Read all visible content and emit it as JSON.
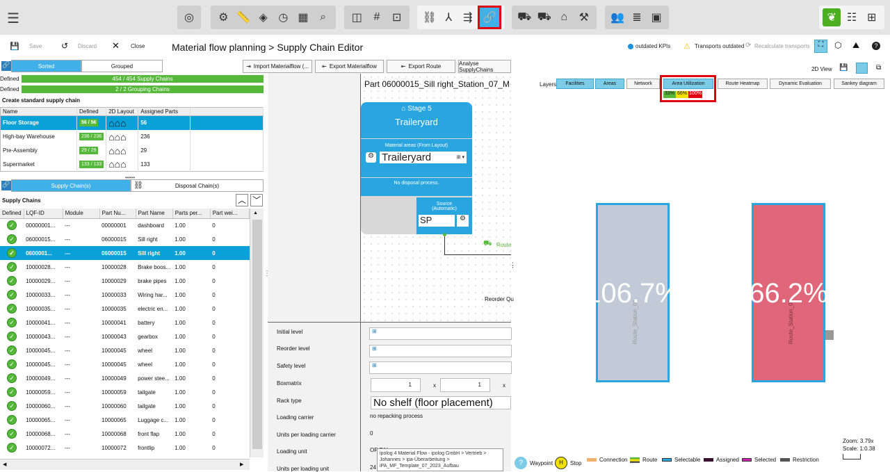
{
  "toolbar": {
    "icons": [
      "menu-icon",
      "target-icon",
      "material-icon",
      "ruler-icon",
      "shapes-icon",
      "clock-icon",
      "matrix-icon",
      "search-chart-icon",
      "layout-icon",
      "grid-icon",
      "area-icon",
      "link-icon",
      "branch-icon",
      "merge-icon",
      "chain-link-icon",
      "truck-icon",
      "truck-2-icon",
      "warehouse-icon",
      "forklift-icon",
      "people-icon",
      "stack-icon",
      "frame-icon",
      "leaf-icon",
      "sliders-icon",
      "structure-icon"
    ]
  },
  "titlebar": {
    "save": "Save",
    "discard": "Discard",
    "close": "Close",
    "breadcrumb_root": "Material flow planning",
    "separator": ">",
    "breadcrumb_page": "Supply Chain Editor",
    "outdated_kpis": "outdated KPIs",
    "transports_outdated": "Transports outdated",
    "recalculate": "Recalculate transports"
  },
  "left": {
    "tabs": {
      "sorted": "Sorted",
      "grouped": "Grouped"
    },
    "defined_label": "Defined",
    "supply_bar": "454 / 454 Supply Chains",
    "grouping_bar": "2 / 2 Grouping Chains",
    "create_title": "Create standard supply chain",
    "std_headers": [
      "Name",
      "Defined",
      "2D Layout",
      "Assigned Parts"
    ],
    "std_rows": [
      {
        "name": "Floor Storage",
        "defined": "56 / 56",
        "parts": "56"
      },
      {
        "name": "High-bay Warehouse",
        "defined": "236 / 236",
        "parts": "236"
      },
      {
        "name": "Pre-Assembly",
        "defined": "29 / 29",
        "parts": "29"
      },
      {
        "name": "Supermarket",
        "defined": "133 / 133",
        "parts": "133"
      }
    ],
    "chain_tabs": {
      "supply": "Supply Chain(s)",
      "disposal": "Disposal Chain(s)"
    },
    "chains_title": "Supply Chains",
    "sc_headers": [
      "Defined",
      "LQF-ID",
      "Module",
      "Part Nu...",
      "Part Name",
      "Parts per...",
      "Part wei..."
    ],
    "sc_rows": [
      {
        "id": "00000001...",
        "module": "---",
        "num": "00000001",
        "name": "dashboard",
        "pp": "1.00",
        "w": "0"
      },
      {
        "id": "06000015...",
        "module": "---",
        "num": "06000015",
        "name": "Sill right",
        "pp": "1.00",
        "w": "0"
      },
      {
        "id": "0600001...",
        "module": "---",
        "num": "06000015",
        "name": "Sill right",
        "pp": "1.00",
        "w": "0"
      },
      {
        "id": "10000028...",
        "module": "---",
        "num": "10000028",
        "name": "Brake boos...",
        "pp": "1.00",
        "w": "0"
      },
      {
        "id": "10000029...",
        "module": "---",
        "num": "10000029",
        "name": "brake pipes",
        "pp": "1.00",
        "w": "0"
      },
      {
        "id": "10000033...",
        "module": "---",
        "num": "10000033",
        "name": "Wiring har...",
        "pp": "1.00",
        "w": "0"
      },
      {
        "id": "10000035...",
        "module": "---",
        "num": "10000035",
        "name": "electric en...",
        "pp": "1.00",
        "w": "0"
      },
      {
        "id": "10000041...",
        "module": "---",
        "num": "10000041",
        "name": "battery",
        "pp": "1.00",
        "w": "0"
      },
      {
        "id": "10000043...",
        "module": "---",
        "num": "10000043",
        "name": "gearbox",
        "pp": "1.00",
        "w": "0"
      },
      {
        "id": "10000045...",
        "module": "---",
        "num": "10000045",
        "name": "wheel",
        "pp": "1.00",
        "w": "0"
      },
      {
        "id": "10000045...",
        "module": "---",
        "num": "10000045",
        "name": "wheel",
        "pp": "1.00",
        "w": "0"
      },
      {
        "id": "10000049...",
        "module": "---",
        "num": "10000049",
        "name": "power stee...",
        "pp": "1.00",
        "w": "0"
      },
      {
        "id": "10000059...",
        "module": "---",
        "num": "10000059",
        "name": "tailgate",
        "pp": "1.00",
        "w": "0"
      },
      {
        "id": "10000060...",
        "module": "---",
        "num": "10000060",
        "name": "tailgate",
        "pp": "1.00",
        "w": "0"
      },
      {
        "id": "10000065...",
        "module": "---",
        "num": "10000065",
        "name": "Luggage c...",
        "pp": "1.00",
        "w": "0"
      },
      {
        "id": "10000068...",
        "module": "---",
        "num": "10000068",
        "name": "front flap",
        "pp": "1.00",
        "w": "0"
      },
      {
        "id": "10000072...",
        "module": "---",
        "num": "10000072",
        "name": "frontlip",
        "pp": "1.00",
        "w": "0"
      }
    ]
  },
  "middle": {
    "buttons": {
      "import": "Import Materialflow (...",
      "export": "Export Materialflow",
      "route": "Export Route",
      "analyse": "Analyse SupplyChains"
    },
    "part_title": "Part 06000015_Sill right_Station_07_M",
    "stage": "Stage 5",
    "stage_name": "Traileryard",
    "material_areas": "Material areas (From Layout)",
    "area_value": "Traileryard",
    "no_disposal": "No disposal process.",
    "source": "Source",
    "automatic": "(Automatic)",
    "source_value": "SP",
    "route_label": "Route",
    "reorder_q": "Reorder Qu",
    "form": {
      "initial": "Initial level",
      "reorder": "Reorder level",
      "safety": "Safety level",
      "boxmatrix": "Boxmatrix",
      "x": "x",
      "box1": "1",
      "box2": "1",
      "rack": "Rack type",
      "rack_value": "No shelf (floor placement)",
      "carrier": "Loading carrier",
      "carrier_value": "no repacking process",
      "units_carrier": "Units per loading carrier",
      "units_carrier_value": "0",
      "loading_unit": "Loading unit",
      "loading_unit_value": "OP PAL",
      "units_per_loading_unit": "Units per loading unit",
      "upl_value": "24"
    },
    "tooltip": [
      "ipolog 4 Material Flow - ipolog GmbH > Vertrieb >",
      "Johannes > ipa-Überarbeitung >",
      "iPA_MF_Template_07_2023_Aufbau"
    ]
  },
  "right": {
    "view_2d": "2D View",
    "layers_label": "Layers",
    "layers": [
      "Facilities",
      "Areas",
      "Network",
      "Area Utilization",
      "Route Heatmap",
      "Dynamic Evaluation",
      "Sankey diagram"
    ],
    "util_scale": [
      "33%",
      "66%",
      "100%"
    ],
    "stations": [
      {
        "name": "Route_Station_01",
        "value": "106.7%",
        "color": "#c1cad6"
      },
      {
        "name": "Route_Station_02",
        "value": "66.2%",
        "color": "#e0667a"
      }
    ],
    "zoom": "Zoom: 3.79x",
    "scale": "Scale: 1:0.38",
    "legend": [
      {
        "label": "Waypoint",
        "color": "#7ccce8"
      },
      {
        "label": "Stop",
        "color": "#f2e000"
      },
      {
        "label": "Connection",
        "color": "#f0b070"
      },
      {
        "label": "Route",
        "color": "#55b83a"
      },
      {
        "label": "Selectable",
        "color": "#29a6e0"
      },
      {
        "label": "Assigned",
        "color": "#3a1030"
      },
      {
        "label": "Selected",
        "color": "#d020b0"
      },
      {
        "label": "Restriction",
        "color": "#555555"
      }
    ]
  }
}
